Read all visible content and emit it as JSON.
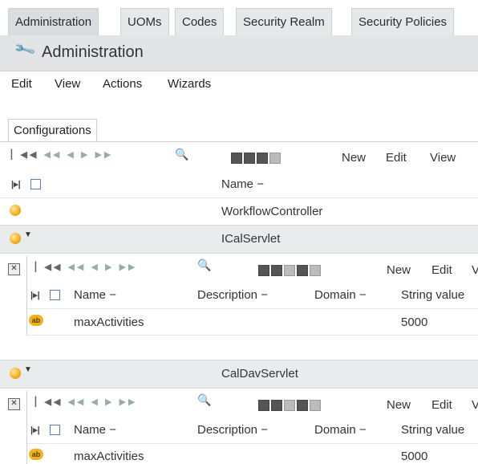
{
  "tabs": [
    "Administration",
    "UOMs",
    "Codes",
    "Security Realm",
    "Security Policies"
  ],
  "header": {
    "title": "Administration",
    "icon": "wrench-icon"
  },
  "menu": [
    "Edit",
    "View",
    "Actions",
    "Wizards"
  ],
  "subtab": "Configurations",
  "toolbar": {
    "new": "New",
    "edit": "Edit",
    "view": "View"
  },
  "main_table": {
    "column_name": "Name",
    "rows": [
      "WorkflowController",
      "ICalServlet"
    ]
  },
  "nested": [
    {
      "group": "ICalServlet",
      "toolbar": {
        "new": "New",
        "edit": "Edit",
        "view": "V"
      },
      "columns": [
        "Name",
        "Description",
        "Domain",
        "String value"
      ],
      "rows": [
        {
          "name": "maxActivities",
          "description": "",
          "domain": "",
          "string_value": "5000"
        }
      ]
    },
    {
      "group": "CalDavServlet",
      "toolbar": {
        "new": "New",
        "edit": "Edit",
        "view": "V"
      },
      "columns": [
        "Name",
        "Description",
        "Domain",
        "String value"
      ],
      "rows": [
        {
          "name": "maxActivities",
          "description": "",
          "domain": "",
          "string_value": "5000"
        }
      ]
    }
  ],
  "sort_marker": "−",
  "ab_label": "ab"
}
